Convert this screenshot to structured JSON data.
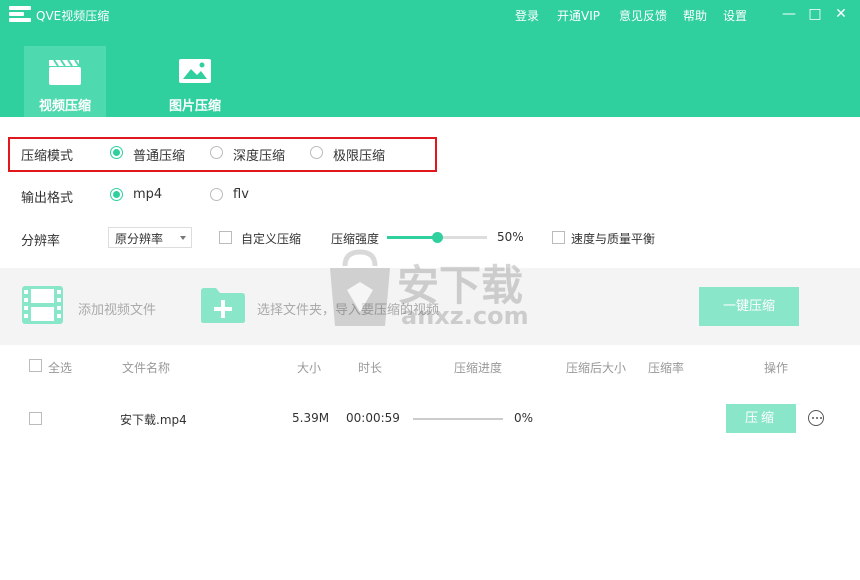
{
  "app": {
    "title": "QVE视频压缩"
  },
  "menu": {
    "login": "登录",
    "vip": "开通VIP",
    "feedback": "意见反馈",
    "help": "帮助",
    "settings": "设置"
  },
  "window_controls": {
    "minimize": "—",
    "maximize": "□",
    "close": "✕"
  },
  "tabs": [
    {
      "label": "视频压缩",
      "icon": "clapperboard-icon",
      "active": true
    },
    {
      "label": "图片压缩",
      "icon": "image-icon",
      "active": false
    }
  ],
  "options": {
    "mode": {
      "label": "压缩模式",
      "choices": [
        "普通压缩",
        "深度压缩",
        "极限压缩"
      ],
      "selected": "普通压缩"
    },
    "format": {
      "label": "输出格式",
      "choices": [
        "mp4",
        "flv"
      ],
      "selected": "mp4"
    },
    "resolution": {
      "label": "分辨率",
      "selected": "原分辨率"
    },
    "custom": {
      "label": "自定义压缩",
      "checked": false
    },
    "strength": {
      "label": "压缩强度",
      "value": 50,
      "display": "50%"
    },
    "balance": {
      "label": "速度与质量平衡",
      "checked": false
    }
  },
  "add_bar": {
    "add_video": "添加视频文件",
    "add_folder": "选择文件夹，导入要压缩的视频",
    "one_click": "一键压缩"
  },
  "table": {
    "select_all": "全选",
    "columns": [
      "文件名称",
      "大小",
      "时长",
      "压缩进度",
      "压缩后大小",
      "压缩率",
      "操作"
    ],
    "rows": [
      {
        "name": "安下载.mp4",
        "size": "5.39M",
        "duration": "00:00:59",
        "progress": 0,
        "progress_text": "0%",
        "action": "压缩"
      }
    ]
  },
  "watermark": {
    "text": "安下载",
    "domain": "anxz.com"
  },
  "colors": {
    "accent": "#2fcf9e",
    "highlight": "#e0171c"
  }
}
